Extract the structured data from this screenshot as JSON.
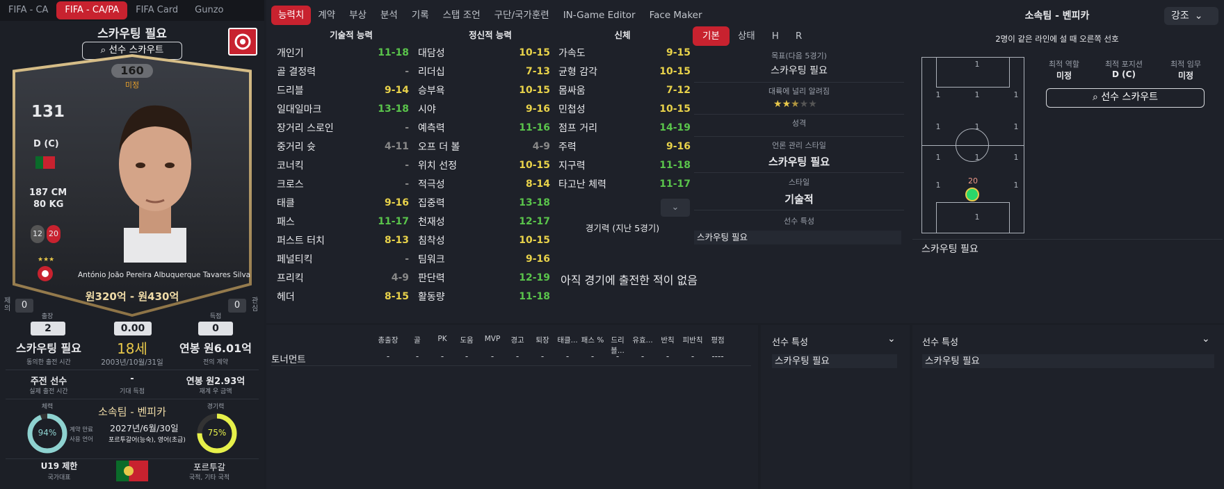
{
  "game_tabs": [
    "FIFA - CA",
    "FIFA - CA/PA",
    "FIFA Card",
    "Gunzo"
  ],
  "player": {
    "title": "스카우팅 필요",
    "scout_btn": "선수 스카우트",
    "ca": "160",
    "ca_sub": "미정",
    "rating": "131",
    "position": "D (C)",
    "height": "187 CM",
    "weight": "80 KG",
    "badge_a": "12",
    "badge_b": "20",
    "full_name": "António João Pereira Albuquerque Tavares Silva",
    "value": "원320억 - 원430억",
    "left_side": "제의",
    "left_num": "0",
    "right_side": "관심",
    "right_num": "0",
    "apps_label": "출장",
    "apps": "2",
    "avg": "0.00",
    "goals_label": "득점",
    "goals": "0",
    "time_val": "스카우팅 필요",
    "time_lbl": "동의한 출전 시간",
    "age": "18세",
    "dob": "2003년/10월/31일",
    "wage": "연봉 원6.01억",
    "wage_lbl": "전의 계약",
    "role": "주전 선수",
    "role_lbl": "실제 출전 시간",
    "exp_goal": "-",
    "exp_lbl": "기대 득점",
    "bonus": "연봉 원2.93억",
    "bonus_lbl": "재계 우 금액",
    "cond_lbl": "체력",
    "cond": "94%",
    "club": "소속팀 - 벤피카",
    "contract": "2027년/6월/30일",
    "contract_lbl1": "계약 만료",
    "contract_lbl2": "사용 언어",
    "language": "포르투갈어(능숙), 영어(초급)",
    "exp2_lbl": "경기력",
    "exp2": "75%",
    "intl": "U19 제한",
    "intl_lbl": "국가대표",
    "nation": "포르투갈",
    "nation_lbl": "국적, 기타 국적"
  },
  "main_tabs": [
    "능력치",
    "계약",
    "부상",
    "분석",
    "기록",
    "스탭 조언",
    "구단/국가훈련",
    "IN-Game Editor",
    "Face Maker"
  ],
  "col_heads": [
    "기술적 능력",
    "정신적 능력",
    "신체"
  ],
  "technical": [
    [
      "개인기",
      "11-18",
      "g"
    ],
    [
      "골 결정력",
      "-",
      "gr"
    ],
    [
      "드리블",
      "9-14",
      "y"
    ],
    [
      "일대일마크",
      "13-18",
      "g"
    ],
    [
      "장거리 스로인",
      "-",
      "gr"
    ],
    [
      "중거리 슛",
      "4-11",
      "gr"
    ],
    [
      "코너킥",
      "-",
      "gr"
    ],
    [
      "크로스",
      "-",
      "gr"
    ],
    [
      "태클",
      "9-16",
      "y"
    ],
    [
      "패스",
      "11-17",
      "g"
    ],
    [
      "퍼스트 터치",
      "8-13",
      "y"
    ],
    [
      "페널티킥",
      "-",
      "gr"
    ],
    [
      "프리킥",
      "4-9",
      "gr"
    ],
    [
      "헤더",
      "8-15",
      "y"
    ]
  ],
  "mental": [
    [
      "대담성",
      "10-15",
      "y"
    ],
    [
      "리더십",
      "7-13",
      "y"
    ],
    [
      "승부욕",
      "10-15",
      "y"
    ],
    [
      "시야",
      "9-16",
      "y"
    ],
    [
      "예측력",
      "11-16",
      "g"
    ],
    [
      "오프 더 볼",
      "4-9",
      "gr"
    ],
    [
      "위치 선정",
      "10-15",
      "y"
    ],
    [
      "적극성",
      "8-14",
      "y"
    ],
    [
      "집중력",
      "13-18",
      "g"
    ],
    [
      "천재성",
      "12-17",
      "g"
    ],
    [
      "침착성",
      "10-15",
      "y"
    ],
    [
      "팀워크",
      "9-16",
      "y"
    ],
    [
      "판단력",
      "12-19",
      "g"
    ],
    [
      "활동량",
      "11-18",
      "g"
    ]
  ],
  "physical": [
    [
      "가속도",
      "9-15",
      "y"
    ],
    [
      "균형 감각",
      "10-15",
      "y"
    ],
    [
      "몸싸움",
      "7-12",
      "y"
    ],
    [
      "민첩성",
      "10-15",
      "y"
    ],
    [
      "점프 거리",
      "14-19",
      "g"
    ],
    [
      "주력",
      "9-16",
      "y"
    ],
    [
      "지구력",
      "11-18",
      "g"
    ],
    [
      "타고난 체력",
      "11-17",
      "g"
    ]
  ],
  "form_title": "경기력 (지난 5경기)",
  "form_empty": "아직 경기에 출전한 적이 없음",
  "info_tabs": [
    "기본",
    "상태",
    "H",
    "R"
  ],
  "info": {
    "goal_lbl": "목표(다음 5경기)",
    "goal": "스카우팅 필요",
    "fame_lbl": "대륙에 널리 알려짐",
    "stars": 2.5,
    "pers_lbl": "성격",
    "media_lbl": "언론 관리 스타일",
    "media": "스카우팅 필요",
    "style_lbl": "스타일",
    "style": "기술적",
    "trait_lbl": "선수 특성",
    "trait": "스카우팅 필요"
  },
  "right": {
    "title": "소속팀 - 벤피카",
    "dropdown": "강조",
    "note": "2명이 같은 라인에 설 때 오른쪽 선호",
    "role_lbl": "최적 역할",
    "role": "미정",
    "pos_lbl": "최적 포지션",
    "pos": "D (C)",
    "duty_lbl": "최적 임무",
    "duty": "미정",
    "scout_btn": "선수 스카우트",
    "player_num": "20",
    "bottom_note": "스카우팅 필요"
  },
  "stats_heads": [
    "총출장",
    "골",
    "PK",
    "도움",
    "MVP",
    "경고",
    "퇴장",
    "태클...",
    "패스 %",
    "드리블...",
    "유효...",
    "반칙",
    "피반칙",
    "평점"
  ],
  "stats_row_label": "토너먼트",
  "stats_row": [
    "-",
    "-",
    "-",
    "-",
    "-",
    "-",
    "-",
    "-",
    "-",
    "-",
    "-",
    "-",
    "-",
    "----"
  ],
  "trait_panel_a": {
    "title": "선수 특성",
    "value": "스카우팅 필요"
  },
  "trait_panel_b": {
    "title": "선수 특성",
    "value": "스카우팅 필요"
  },
  "colors": {
    "accent": "#c8222f",
    "yellow": "#e8d24a",
    "green": "#5ac44b",
    "gold": "#d9c08a"
  }
}
